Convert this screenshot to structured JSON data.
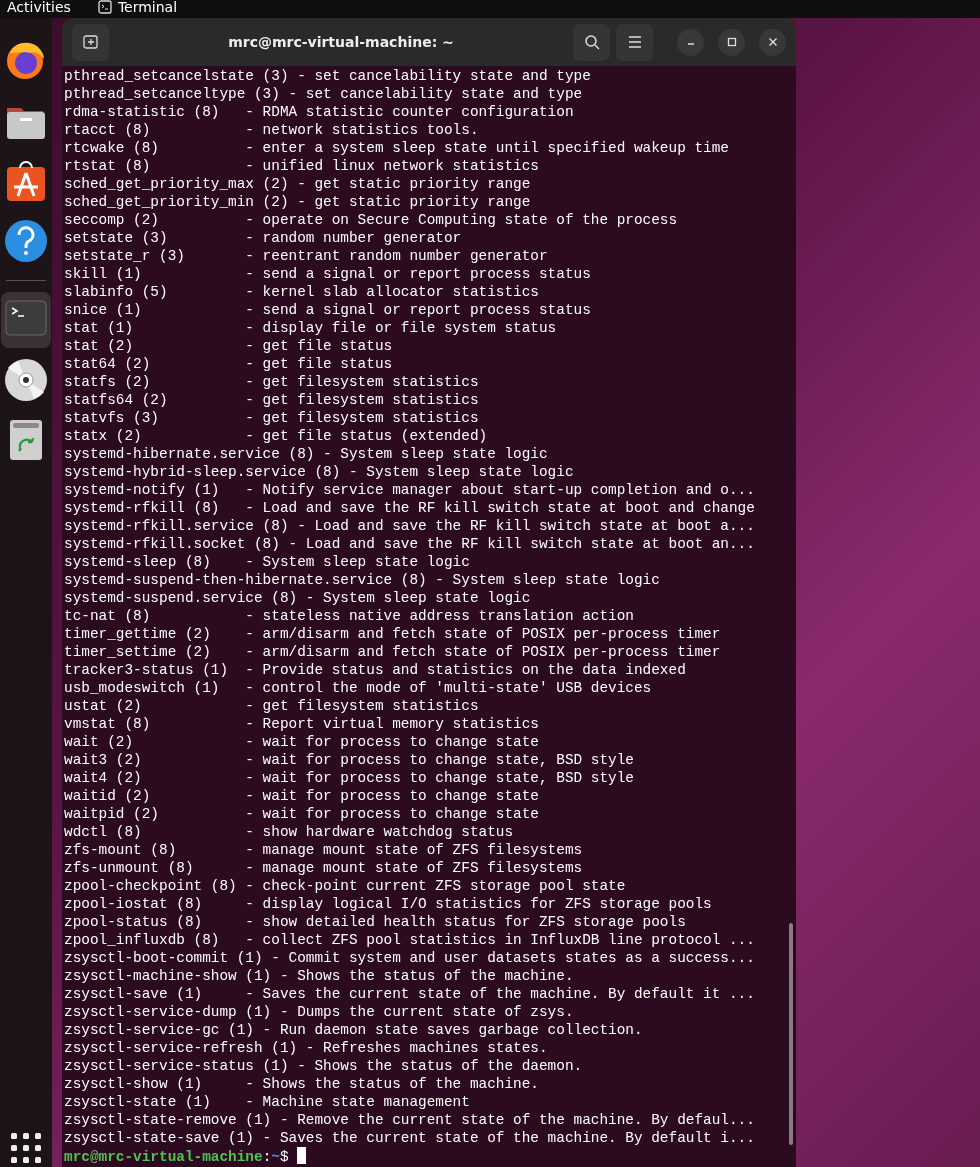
{
  "top_bar": {
    "activities": "Activities",
    "app_name": "Terminal"
  },
  "dock": [
    {
      "kind": "browser",
      "selected": false
    },
    {
      "kind": "files",
      "selected": false
    },
    {
      "kind": "store",
      "selected": false
    },
    {
      "kind": "help",
      "selected": false
    },
    {
      "kind": "terminal",
      "selected": true
    },
    {
      "kind": "disc",
      "selected": false
    },
    {
      "kind": "trash",
      "selected": false
    }
  ],
  "window": {
    "title": "mrc@mrc-virtual-machine: ~"
  },
  "terminal": {
    "lines": [
      "pthread_setcancelstate (3) - set cancelability state and type",
      "pthread_setcanceltype (3) - set cancelability state and type",
      "rdma-statistic (8)   - RDMA statistic counter configuration",
      "rtacct (8)           - network statistics tools.",
      "rtcwake (8)          - enter a system sleep state until specified wakeup time",
      "rtstat (8)           - unified linux network statistics",
      "sched_get_priority_max (2) - get static priority range",
      "sched_get_priority_min (2) - get static priority range",
      "seccomp (2)          - operate on Secure Computing state of the process",
      "setstate (3)         - random number generator",
      "setstate_r (3)       - reentrant random number generator",
      "skill (1)            - send a signal or report process status",
      "slabinfo (5)         - kernel slab allocator statistics",
      "snice (1)            - send a signal or report process status",
      "stat (1)             - display file or file system status",
      "stat (2)             - get file status",
      "stat64 (2)           - get file status",
      "statfs (2)           - get filesystem statistics",
      "statfs64 (2)         - get filesystem statistics",
      "statvfs (3)          - get filesystem statistics",
      "statx (2)            - get file status (extended)",
      "systemd-hibernate.service (8) - System sleep state logic",
      "systemd-hybrid-sleep.service (8) - System sleep state logic",
      "systemd-notify (1)   - Notify service manager about start-up completion and o...",
      "systemd-rfkill (8)   - Load and save the RF kill switch state at boot and change",
      "systemd-rfkill.service (8) - Load and save the RF kill switch state at boot a...",
      "systemd-rfkill.socket (8) - Load and save the RF kill switch state at boot an...",
      "systemd-sleep (8)    - System sleep state logic",
      "systemd-suspend-then-hibernate.service (8) - System sleep state logic",
      "systemd-suspend.service (8) - System sleep state logic",
      "tc-nat (8)           - stateless native address translation action",
      "timer_gettime (2)    - arm/disarm and fetch state of POSIX per-process timer",
      "timer_settime (2)    - arm/disarm and fetch state of POSIX per-process timer",
      "tracker3-status (1)  - Provide status and statistics on the data indexed",
      "usb_modeswitch (1)   - control the mode of 'multi-state' USB devices",
      "ustat (2)            - get filesystem statistics",
      "vmstat (8)           - Report virtual memory statistics",
      "wait (2)             - wait for process to change state",
      "wait3 (2)            - wait for process to change state, BSD style",
      "wait4 (2)            - wait for process to change state, BSD style",
      "waitid (2)           - wait for process to change state",
      "waitpid (2)          - wait for process to change state",
      "wdctl (8)            - show hardware watchdog status",
      "zfs-mount (8)        - manage mount state of ZFS filesystems",
      "zfs-unmount (8)      - manage mount state of ZFS filesystems",
      "zpool-checkpoint (8) - check-point current ZFS storage pool state",
      "zpool-iostat (8)     - display logical I/O statistics for ZFS storage pools",
      "zpool-status (8)     - show detailed health status for ZFS storage pools",
      "zpool_influxdb (8)   - collect ZFS pool statistics in InfluxDB line protocol ...",
      "zsysctl-boot-commit (1) - Commit system and user datasets states as a success...",
      "zsysctl-machine-show (1) - Shows the status of the machine.",
      "zsysctl-save (1)     - Saves the current state of the machine. By default it ...",
      "zsysctl-service-dump (1) - Dumps the current state of zsys.",
      "zsysctl-service-gc (1) - Run daemon state saves garbage collection.",
      "zsysctl-service-refresh (1) - Refreshes machines states.",
      "zsysctl-service-status (1) - Shows the status of the daemon.",
      "zsysctl-show (1)     - Shows the status of the machine.",
      "zsysctl-state (1)    - Machine state management",
      "zsysctl-state-remove (1) - Remove the current state of the machine. By defaul...",
      "zsysctl-state-save (1) - Saves the current state of the machine. By default i..."
    ],
    "prompt": {
      "user_host": "mrc@mrc-virtual-machine",
      "separator": ":",
      "path": "~",
      "symbol": "$"
    }
  }
}
